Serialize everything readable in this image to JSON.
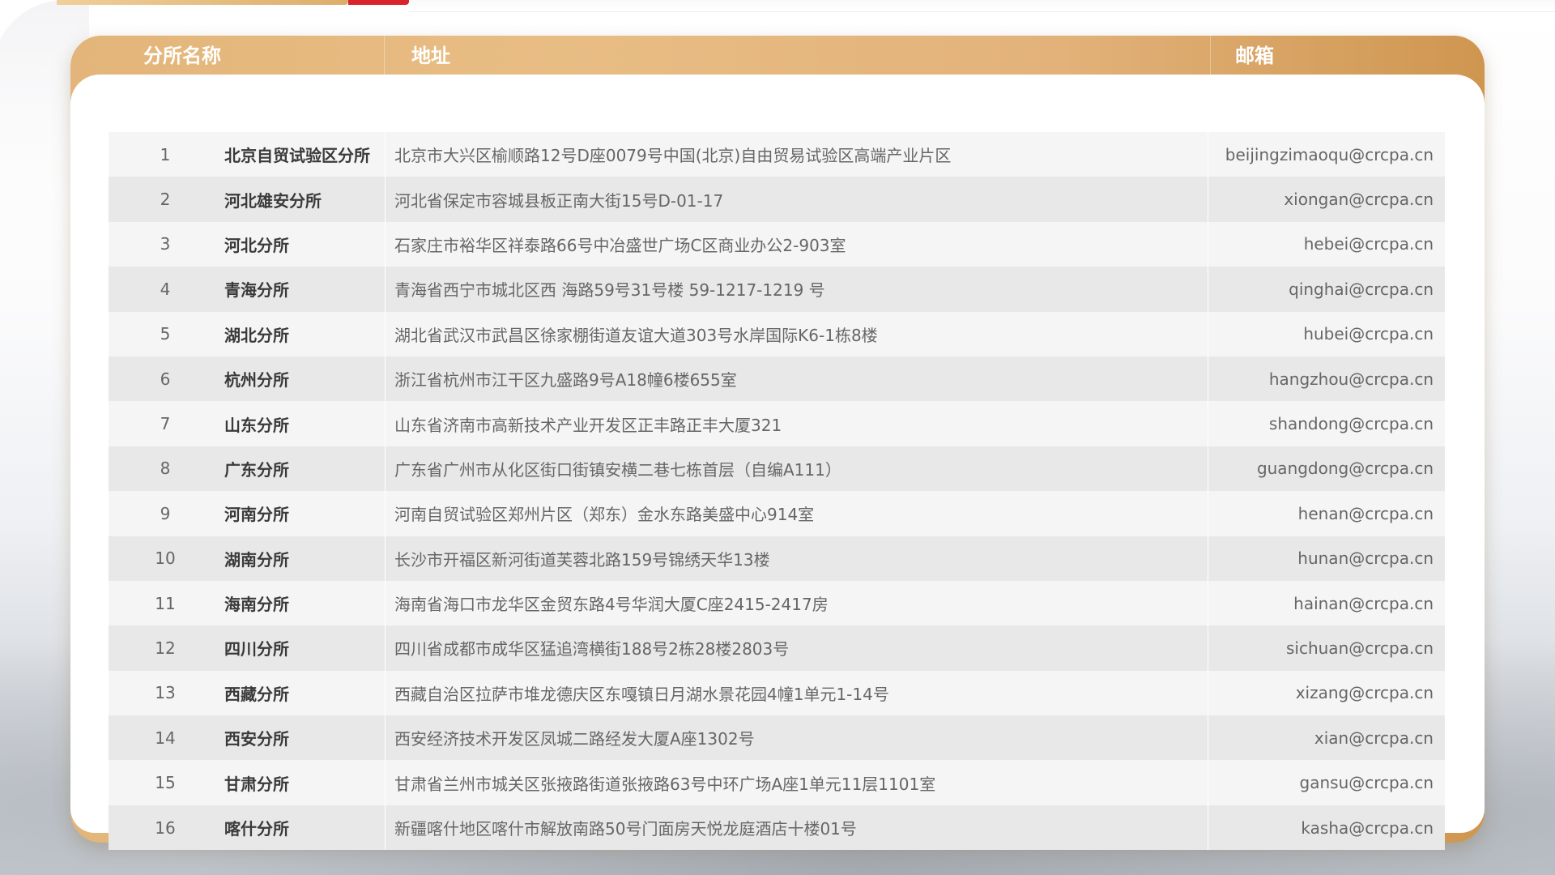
{
  "table": {
    "headers": {
      "name": "分所名称",
      "address": "地址",
      "email": "邮箱"
    },
    "rows": [
      {
        "index": "1",
        "name": "北京自贸试验区分所",
        "address": "北京市大兴区榆顺路12号D座0079号中国(北京)自由贸易试验区高端产业片区",
        "email": "beijingzimaoqu@crcpa.cn"
      },
      {
        "index": "2",
        "name": "河北雄安分所",
        "address": "河北省保定市容城县板正南大街15号D-01-17",
        "email": "xiongan@crcpa.cn"
      },
      {
        "index": "3",
        "name": "河北分所",
        "address": "石家庄市裕华区祥泰路66号中冶盛世广场C区商业办公2-903室",
        "email": "hebei@crcpa.cn"
      },
      {
        "index": "4",
        "name": "青海分所",
        "address": "青海省西宁市城北区西 海路59号31号楼 59-1217-1219 号",
        "email": "qinghai@crcpa.cn"
      },
      {
        "index": "5",
        "name": "湖北分所",
        "address": "湖北省武汉市武昌区徐家棚街道友谊大道303号水岸国际K6-1栋8楼",
        "email": "hubei@crcpa.cn"
      },
      {
        "index": "6",
        "name": "杭州分所",
        "address": "浙江省杭州市江干区九盛路9号A18幢6楼655室",
        "email": "hangzhou@crcpa.cn"
      },
      {
        "index": "7",
        "name": "山东分所",
        "address": "山东省济南市高新技术产业开发区正丰路正丰大厦321",
        "email": "shandong@crcpa.cn"
      },
      {
        "index": "8",
        "name": "广东分所",
        "address": "广东省广州市从化区街口街镇安横二巷七栋首层（自编A111）",
        "email": "guangdong@crcpa.cn"
      },
      {
        "index": "9",
        "name": "河南分所",
        "address": "河南自贸试验区郑州片区（郑东）金水东路美盛中心914室",
        "email": "henan@crcpa.cn"
      },
      {
        "index": "10",
        "name": "湖南分所",
        "address": "长沙市开福区新河街道芙蓉北路159号锦绣天华13楼",
        "email": "hunan@crcpa.cn"
      },
      {
        "index": "11",
        "name": "海南分所",
        "address": "海南省海口市龙华区金贸东路4号华润大厦C座2415-2417房",
        "email": "hainan@crcpa.cn"
      },
      {
        "index": "12",
        "name": "四川分所",
        "address": "四川省成都市成华区猛追湾横街188号2栋28楼2803号",
        "email": "sichuan@crcpa.cn"
      },
      {
        "index": "13",
        "name": "西藏分所",
        "address": "西藏自治区拉萨市堆龙德庆区东嘎镇日月湖水景花园4幢1单元1-14号",
        "email": "xizang@crcpa.cn"
      },
      {
        "index": "14",
        "name": "西安分所",
        "address": "西安经济技术开发区凤城二路经发大厦A座1302号",
        "email": "xian@crcpa.cn"
      },
      {
        "index": "15",
        "name": "甘肃分所",
        "address": "甘肃省兰州市城关区张掖路街道张掖路63号中环广场A座1单元11层1101室",
        "email": "gansu@crcpa.cn"
      },
      {
        "index": "16",
        "name": "喀什分所",
        "address": "新疆喀什地区喀什市解放南路50号门面房天悦龙庭酒店十楼01号",
        "email": "kasha@crcpa.cn"
      }
    ]
  },
  "colors": {
    "header_gold": "#e3b57a",
    "accent_red": "#d9232d",
    "row_odd": "#f5f5f5",
    "row_even": "#e8e8e8"
  }
}
